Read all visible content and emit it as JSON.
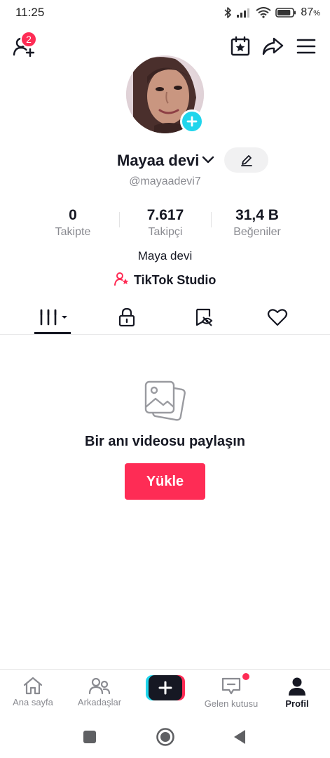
{
  "status_bar": {
    "time": "11:25",
    "battery_percent": "87",
    "battery_unit": "%",
    "battery_level": 0.87,
    "icons": [
      "bluetooth-icon",
      "signal-icon",
      "wifi-icon",
      "battery-icon"
    ]
  },
  "header": {
    "icons": [
      "add-friends-icon",
      "calendar-star-icon",
      "share-icon",
      "menu-icon"
    ],
    "notification_count": "2"
  },
  "profile": {
    "name": "Mayaa devi",
    "handle": "@mayaadevi7",
    "bio": "Maya devi",
    "studio_label": "TikTok Studio",
    "stats": [
      {
        "value": "0",
        "label": "Takipte"
      },
      {
        "value": "7.617",
        "label": "Takipçi"
      },
      {
        "value": "31,4 B",
        "label": "Beğeniler"
      }
    ]
  },
  "tabs": [
    "videos-grid-icon",
    "lock-icon",
    "reposts-icon",
    "heart-icon"
  ],
  "empty_state": {
    "title": "Bir anı videosu paylaşın",
    "button_label": "Yükle"
  },
  "bottom_nav": {
    "items": [
      {
        "label": "Ana sayfa",
        "icon": "home-icon"
      },
      {
        "label": "Arkadaşlar",
        "icon": "friends-icon"
      },
      {
        "label": "",
        "icon": "create-icon"
      },
      {
        "label": "Gelen kutusu",
        "icon": "inbox-icon"
      },
      {
        "label": "Profil",
        "icon": "profile-icon"
      }
    ]
  },
  "colors": {
    "accent": "#fe2c55",
    "cyan": "#20d5ec",
    "text_primary": "#161823",
    "text_secondary": "#8a8b91"
  }
}
